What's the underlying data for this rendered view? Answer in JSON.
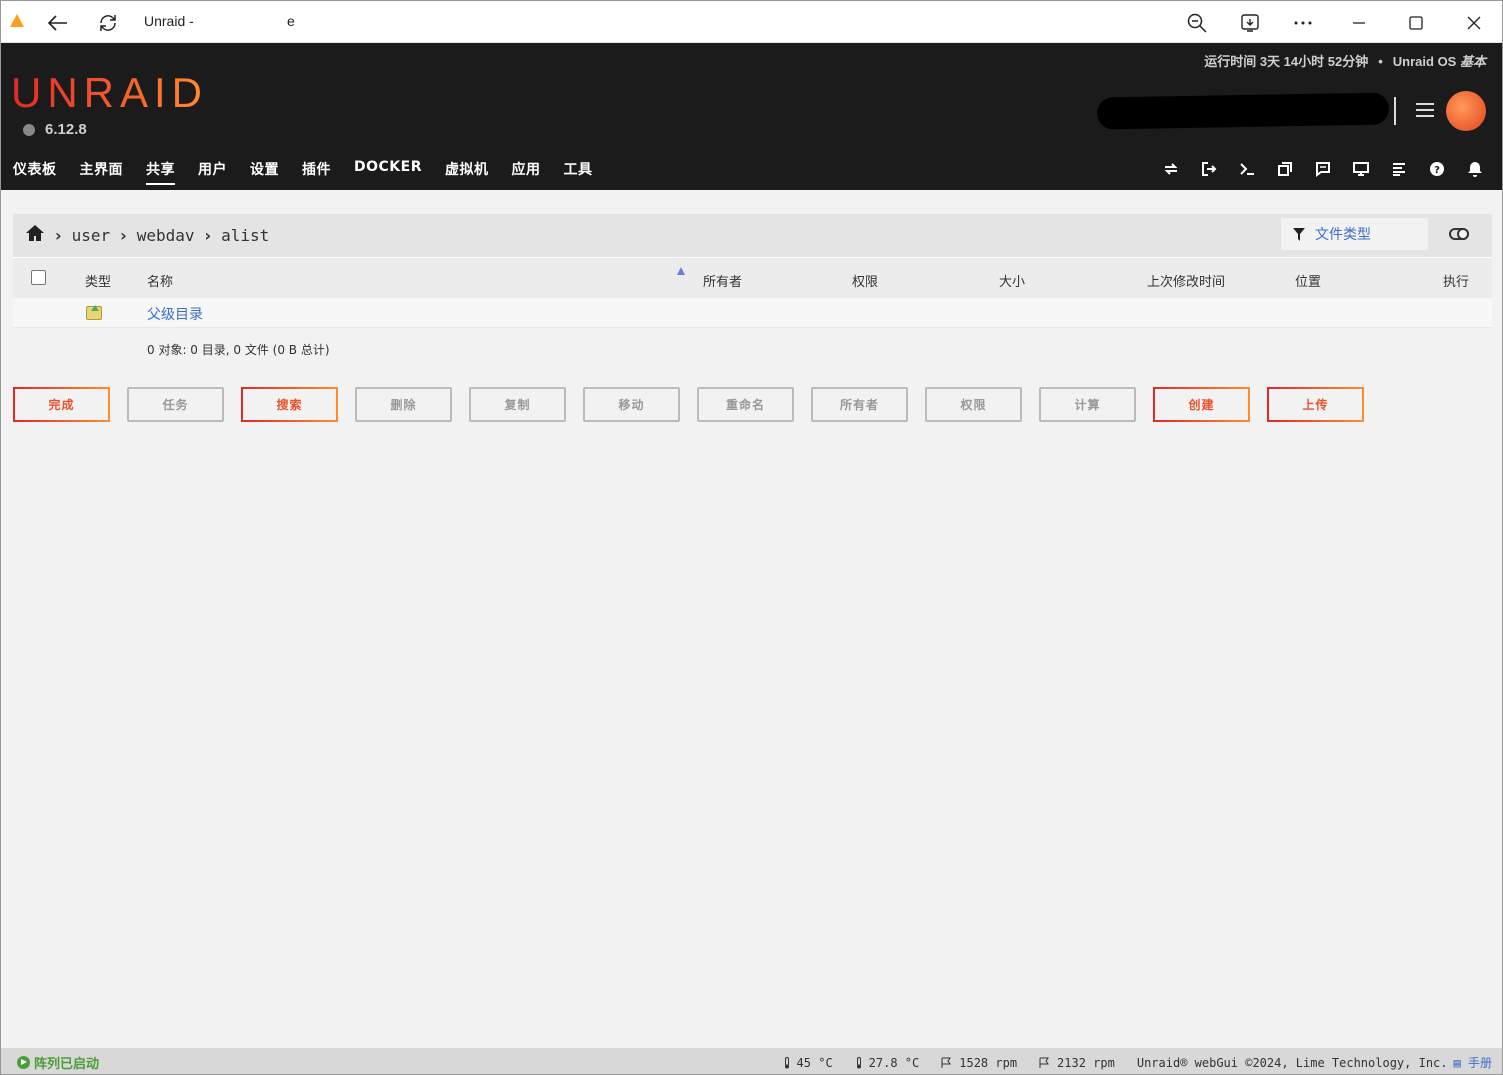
{
  "browser": {
    "tab_title": "Unraid -",
    "tab_title_end": "e"
  },
  "header": {
    "uptime": "运行时间 3天 14小时 52分钟",
    "os_label": "Unraid OS",
    "os_edition": "基本",
    "logo": "UNRAID",
    "version": "6.12.8"
  },
  "nav": {
    "items": [
      "仪表板",
      "主界面",
      "共享",
      "用户",
      "设置",
      "插件",
      "DOCKER",
      "虚拟机",
      "应用",
      "工具"
    ],
    "active": "共享"
  },
  "breadcrumb": {
    "items": [
      "user",
      "webdav",
      "alist"
    ]
  },
  "filter": {
    "label": "文件类型"
  },
  "table": {
    "headers": {
      "type": "类型",
      "name": "名称",
      "owner": "所有者",
      "permissions": "权限",
      "size": "大小",
      "modified": "上次修改时间",
      "location": "位置",
      "action": "执行"
    },
    "parent_dir": "父级目录",
    "summary": "0 对象: 0 目录, 0 文件 (0 B 总计)"
  },
  "actions": {
    "done": "完成",
    "jobs": "任务",
    "search": "搜索",
    "delete": "删除",
    "copy": "复制",
    "move": "移动",
    "rename": "重命名",
    "owner": "所有者",
    "permissions": "权限",
    "calculate": "计算",
    "create": "创建",
    "upload": "上传"
  },
  "footer": {
    "status": "阵列已启动",
    "cpu_temp": "45 °C",
    "mb_temp": "27.8 °C",
    "fan1": "1528 rpm",
    "fan2": "2132 rpm",
    "copyright": "Unraid® webGui ©2024, Lime Technology, Inc.",
    "manual": "手册"
  },
  "colors": {
    "brand_start": "#e22828",
    "brand_end": "#ff8c2f",
    "link": "#3c6fc7",
    "status_green": "#4a9e3a"
  }
}
